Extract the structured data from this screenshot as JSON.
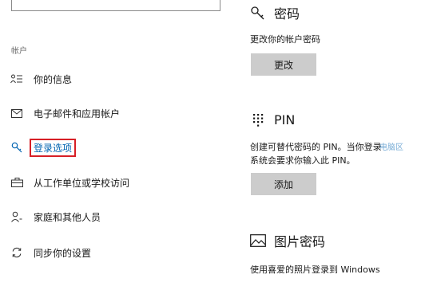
{
  "sidebar": {
    "section_title": "帐户",
    "items": [
      {
        "label": "你的信息",
        "icon": "person-list-icon"
      },
      {
        "label": "电子邮件和应用帐户",
        "icon": "mail-icon"
      },
      {
        "label": "登录选项",
        "icon": "key-icon",
        "selected": true
      },
      {
        "label": "从工作单位或学校访问",
        "icon": "briefcase-icon"
      },
      {
        "label": "家庭和其他人员",
        "icon": "person-add-icon"
      },
      {
        "label": "同步你的设置",
        "icon": "sync-icon"
      }
    ]
  },
  "password": {
    "title": "密码",
    "description": "更改你的帐户密码",
    "button": "更改"
  },
  "pin": {
    "title": "PIN",
    "description_line1": "创建可替代密码的 PIN。当你登录",
    "description_line2": "系统会要求你输入此 PIN。",
    "button": "添加"
  },
  "picture_password": {
    "title": "图片密码",
    "description": "使用喜爱的照片登录到 Windows"
  },
  "watermark": "电脑区",
  "colors": {
    "accent": "#0063b1",
    "highlight_border": "#d71f26",
    "button_bg": "#cccccc"
  }
}
